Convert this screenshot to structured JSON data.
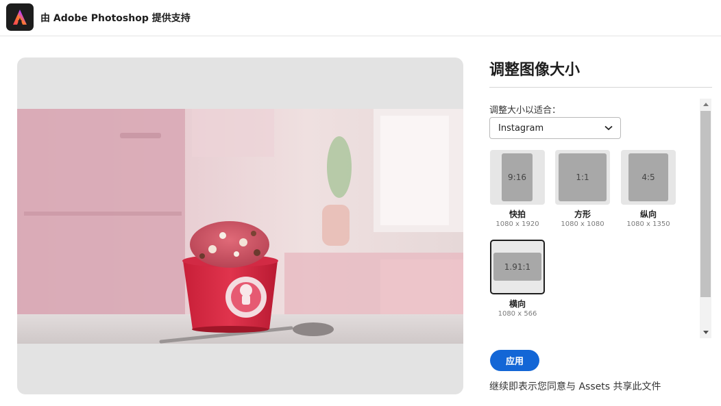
{
  "header": {
    "logo_icon": "adobe-express-logo",
    "title": "由 Adobe Photoshop 提供支持"
  },
  "preview": {
    "image_description_icon": "ice-cream-cup-photo"
  },
  "panel": {
    "title": "调整图像大小",
    "fit_label": "调整大小以适合：",
    "platform_select": {
      "value": "Instagram",
      "icon": "chevron-down-icon"
    },
    "options": [
      {
        "ratio": "9:16",
        "name": "快拍",
        "dims": "1080 x 1920",
        "selected": false
      },
      {
        "ratio": "1:1",
        "name": "方形",
        "dims": "1080 x 1080",
        "selected": false
      },
      {
        "ratio": "4:5",
        "name": "纵向",
        "dims": "1080 x 1350",
        "selected": false
      },
      {
        "ratio": "1.91:1",
        "name": "横向",
        "dims": "1080 x 566",
        "selected": true
      }
    ],
    "apply_label": "应用",
    "consent_text": "继续即表示您同意与 Assets 共享此文件"
  },
  "colors": {
    "accent": "#1366d6",
    "selected_border": "#1d1d1d"
  }
}
